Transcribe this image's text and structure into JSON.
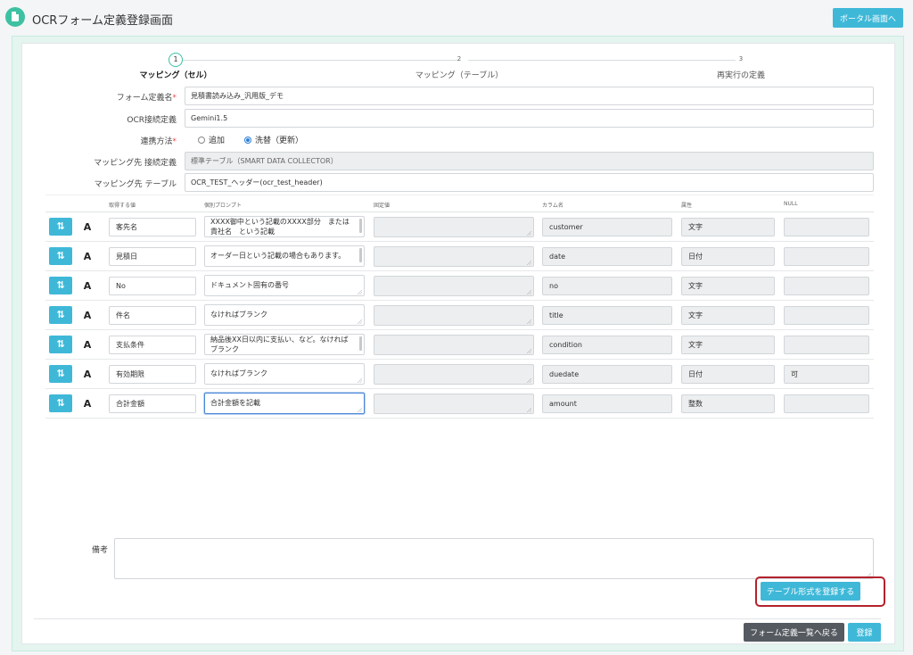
{
  "app": {
    "title": "OCRフォーム定義登録画面",
    "portal_button": "ポータル画面へ"
  },
  "stepper": {
    "steps": [
      {
        "number": "1",
        "label": "マッピング（セル）",
        "active": true
      },
      {
        "number": "2",
        "label": "マッピング（テーブル）",
        "active": false
      },
      {
        "number": "3",
        "label": "再実行の定義",
        "active": false
      }
    ]
  },
  "form": {
    "form_name_label": "フォーム定義名",
    "form_name_value": "見積書読み込み_汎用版_デモ",
    "ocr_connection_label": "OCR接続定義",
    "ocr_connection_value": "Gemini1.5",
    "link_method_label": "連携方法",
    "link_method_options": [
      "追加",
      "洗替（更新）"
    ],
    "link_method_selected": "洗替（更新）",
    "mapping_connection_label": "マッピング先 接続定義",
    "mapping_connection_value": "標準テーブル（SMART DATA COLLECTOR）",
    "mapping_table_label": "マッピング先 テーブル",
    "mapping_table_value": "OCR_TEST_ヘッダー(ocr_test_header)"
  },
  "table": {
    "headers": {
      "value": "取得する値",
      "prompt": "個別プロンプト",
      "fixed": "固定値",
      "column": "カラム名",
      "attribute": "属性",
      "null": "NULL"
    },
    "swap_icon_glyph": "⇅",
    "font_button_label": "A",
    "rows": [
      {
        "value": "客先名",
        "prompt": "XXXX御中という記載のXXXX部分　または貴社名　という記載",
        "fixed": "",
        "column": "customer",
        "attribute": "文字",
        "null": ""
      },
      {
        "value": "見積日",
        "prompt": "オーダー日という記載の場合もあります。",
        "fixed": "",
        "column": "date",
        "attribute": "日付",
        "null": ""
      },
      {
        "value": "No",
        "prompt": "ドキュメント固有の番号",
        "fixed": "",
        "column": "no",
        "attribute": "文字",
        "null": ""
      },
      {
        "value": "件名",
        "prompt": "なければブランク",
        "fixed": "",
        "column": "title",
        "attribute": "文字",
        "null": ""
      },
      {
        "value": "支払条件",
        "prompt": "納品後XX日以内に支払い、など。なければブランク",
        "fixed": "",
        "column": "condition",
        "attribute": "文字",
        "null": ""
      },
      {
        "value": "有効期限",
        "prompt": "なければブランク",
        "fixed": "",
        "column": "duedate",
        "attribute": "日付",
        "null": "可"
      },
      {
        "value": "合計金額",
        "prompt": "合計金額を記載",
        "fixed": "",
        "column": "amount",
        "attribute": "整数",
        "null": ""
      }
    ]
  },
  "notes": {
    "label": "備考",
    "value": ""
  },
  "actions": {
    "register_table_format": "テーブル形式を登録する",
    "back_to_list": "フォーム定義一覧へ戻る",
    "register": "登録"
  },
  "colors": {
    "accent": "#3fb8d8",
    "brand": "#3ec1a2",
    "highlight": "#b3222c",
    "dark_button": "#555a60"
  }
}
